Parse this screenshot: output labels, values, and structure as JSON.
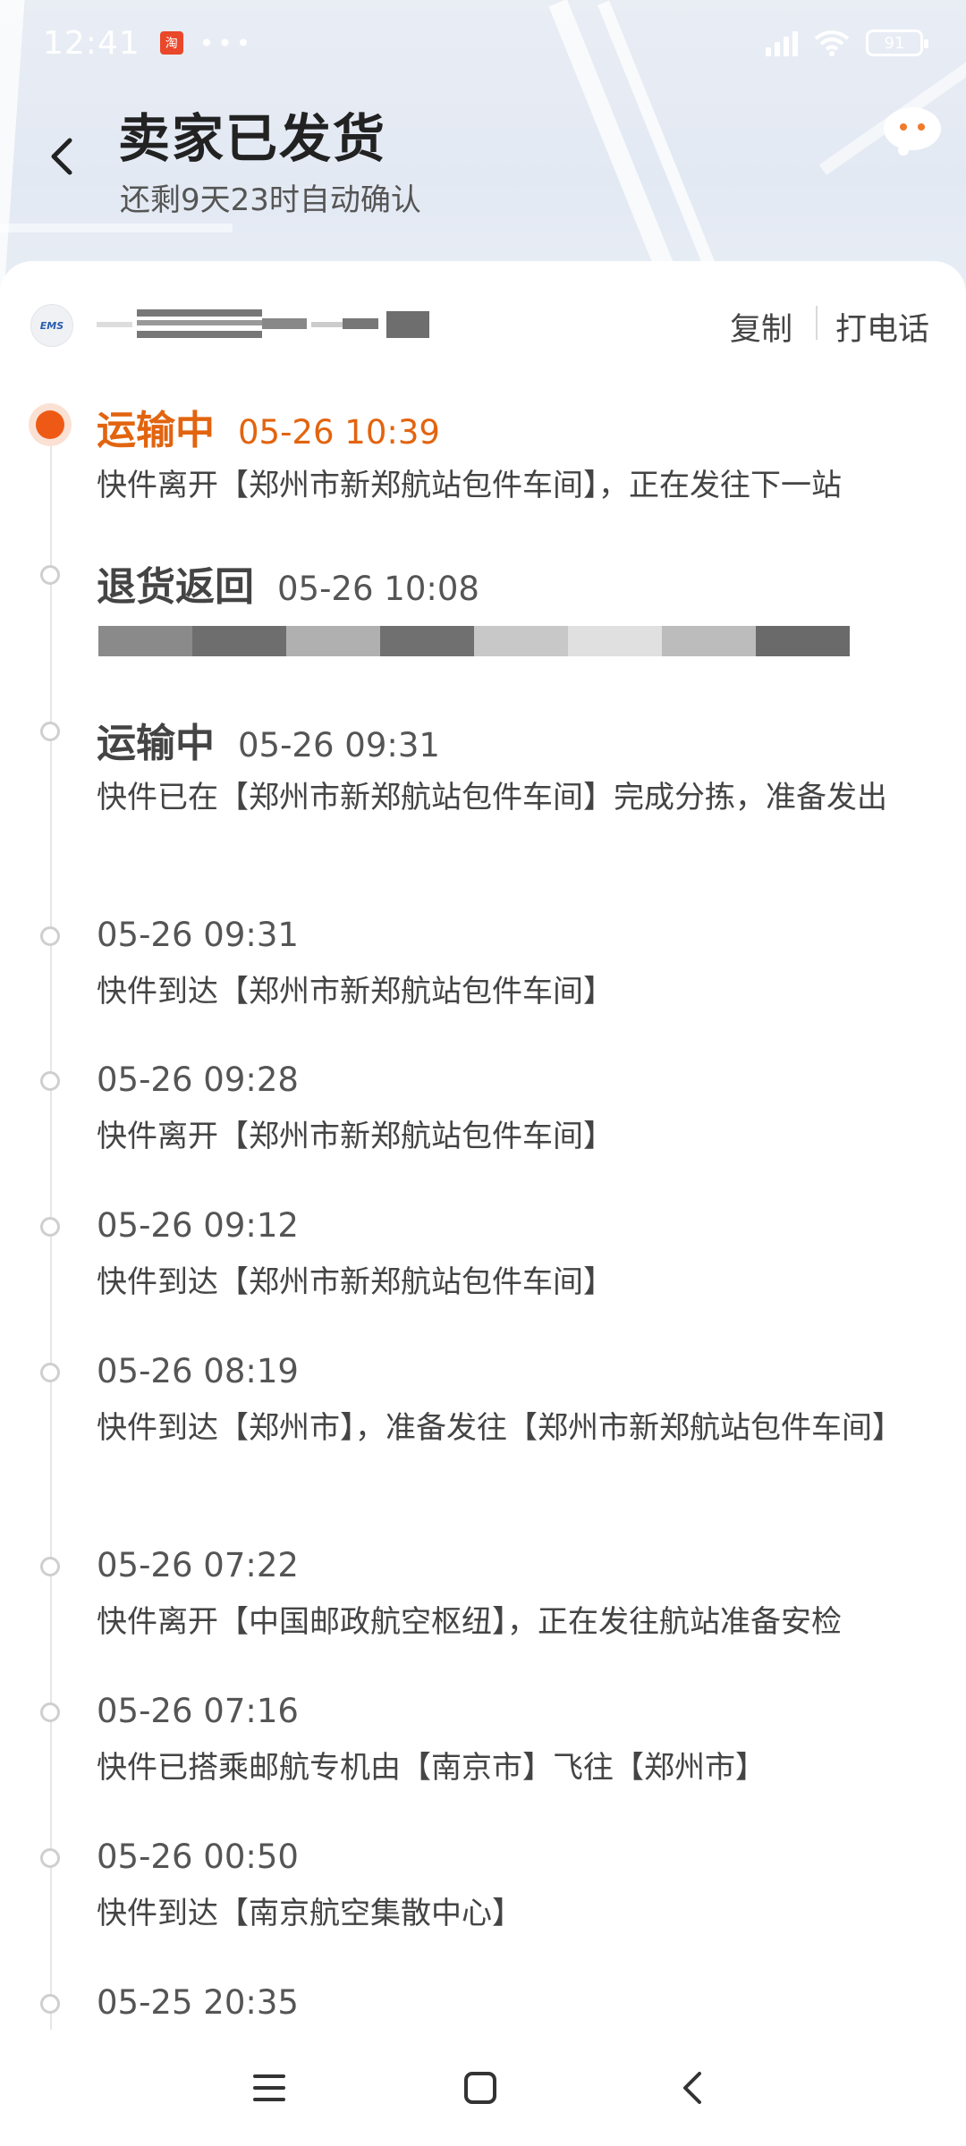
{
  "status_bar": {
    "time": "12:41",
    "app_chip": "淘",
    "dots": "•••",
    "battery": "91"
  },
  "header": {
    "title": "卖家已发货",
    "subtitle": "还剩9天23时自动确认"
  },
  "carrier": {
    "logo_text": "EMS",
    "copy_label": "复制",
    "call_label": "打电话"
  },
  "events": [
    {
      "status": "运输中",
      "time": "05-26 10:39",
      "desc": "快件离开【郑州市新郑航站包件车间】，正在发往下一站"
    },
    {
      "status": "退货返回",
      "time": "05-26 10:08",
      "desc": ""
    },
    {
      "status": "运输中",
      "time": "05-26 09:31",
      "desc": "快件已在【郑州市新郑航站包件车间】完成分拣，准备发出"
    },
    {
      "status": "",
      "time": "05-26 09:31",
      "desc": "快件到达【郑州市新郑航站包件车间】"
    },
    {
      "status": "",
      "time": "05-26 09:28",
      "desc": "快件离开【郑州市新郑航站包件车间】"
    },
    {
      "status": "",
      "time": "05-26 09:12",
      "desc": "快件到达【郑州市新郑航站包件车间】"
    },
    {
      "status": "",
      "time": "05-26 08:19",
      "desc": "快件到达【郑州市】，准备发往【郑州市新郑航站包件车间】"
    },
    {
      "status": "",
      "time": "05-26 07:22",
      "desc": "快件离开【中国邮政航空枢纽】，正在发往航站准备安检"
    },
    {
      "status": "",
      "time": "05-26 07:16",
      "desc": "快件已搭乘邮航专机由【南京市】飞往【郑州市】"
    },
    {
      "status": "",
      "time": "05-26 00:50",
      "desc": "快件到达【南京航空集散中心】"
    },
    {
      "status": "",
      "time": "05-25 20:35",
      "desc": ""
    }
  ],
  "colors": {
    "accent": "#ee5a16",
    "accent_text": "#e2640f",
    "dot_inactive": "#cfcfcf"
  },
  "icons": {
    "back": "chevron-left-icon",
    "chat": "chat-bubble-icon",
    "nav_menu": "menu-icon",
    "nav_home": "home-square-icon",
    "nav_back": "back-arrow-icon"
  }
}
